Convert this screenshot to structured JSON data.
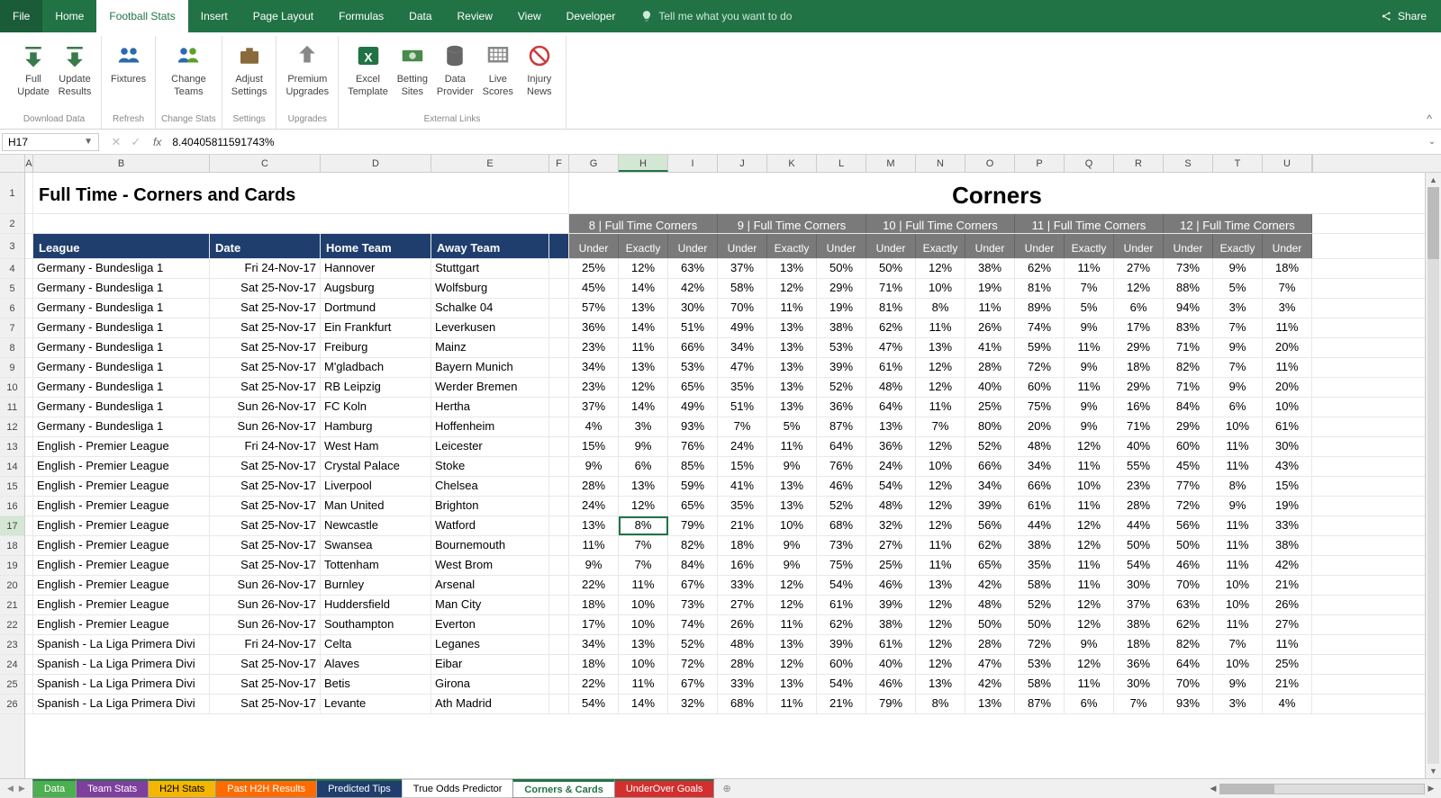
{
  "menu": {
    "file": "File",
    "home": "Home",
    "football": "Football Stats",
    "insert": "Insert",
    "page_layout": "Page Layout",
    "formulas": "Formulas",
    "data": "Data",
    "review": "Review",
    "view": "View",
    "developer": "Developer",
    "tellme": "Tell me what you want to do",
    "share": "Share"
  },
  "ribbon": {
    "full_update": "Full\nUpdate",
    "update_results": "Update\nResults",
    "download_data": "Download Data",
    "fixtures": "Fixtures",
    "refresh": "Refresh",
    "change_teams": "Change\nTeams",
    "change_stats": "Change Stats",
    "adjust_settings": "Adjust\nSettings",
    "settings": "Settings",
    "premium_upgrades": "Premium\nUpgrades",
    "upgrades": "Upgrades",
    "excel_template": "Excel\nTemplate",
    "betting_sites": "Betting\nSites",
    "data_provider": "Data\nProvider",
    "live_scores": "Live\nScores",
    "injury_news": "Injury\nNews",
    "external_links": "External Links"
  },
  "namebox": {
    "ref": "H17"
  },
  "formula": {
    "value": "8.40405811591743%"
  },
  "titles": {
    "main": "Full Time - Corners and Cards",
    "corners": "Corners"
  },
  "col_letters": [
    "A",
    "B",
    "C",
    "D",
    "E",
    "F",
    "G",
    "H",
    "I",
    "J",
    "K",
    "L",
    "M",
    "N",
    "O",
    "P",
    "Q",
    "R",
    "S",
    "T",
    "U"
  ],
  "col_widths": [
    "cw-A",
    "cw-B",
    "cw-C",
    "cw-D",
    "cw-E",
    "cw-F",
    "cw-num",
    "cw-num",
    "cw-num",
    "cw-num",
    "cw-num",
    "cw-num",
    "cw-num",
    "cw-num",
    "cw-num",
    "cw-num",
    "cw-num",
    "cw-num",
    "cw-num",
    "cw-num",
    "cw-num"
  ],
  "headers": {
    "league": "League",
    "date": "Date",
    "home": "Home Team",
    "away": "Away Team",
    "groups": [
      "8 | Full Time Corners",
      "9 | Full Time Corners",
      "10 | Full Time Corners",
      "11 | Full Time Corners",
      "12 | Full Time Corners"
    ],
    "sub": [
      "Under",
      "Exactly",
      "Under"
    ]
  },
  "rows": [
    {
      "n": 4,
      "league": "Germany - Bundesliga 1",
      "date": "Fri 24-Nov-17",
      "home": "Hannover",
      "away": "Stuttgart",
      "v": [
        "25%",
        "12%",
        "63%",
        "37%",
        "13%",
        "50%",
        "50%",
        "12%",
        "38%",
        "62%",
        "11%",
        "27%",
        "73%",
        "9%",
        "18%"
      ]
    },
    {
      "n": 5,
      "league": "Germany - Bundesliga 1",
      "date": "Sat 25-Nov-17",
      "home": "Augsburg",
      "away": "Wolfsburg",
      "v": [
        "45%",
        "14%",
        "42%",
        "58%",
        "12%",
        "29%",
        "71%",
        "10%",
        "19%",
        "81%",
        "7%",
        "12%",
        "88%",
        "5%",
        "7%"
      ]
    },
    {
      "n": 6,
      "league": "Germany - Bundesliga 1",
      "date": "Sat 25-Nov-17",
      "home": "Dortmund",
      "away": "Schalke 04",
      "v": [
        "57%",
        "13%",
        "30%",
        "70%",
        "11%",
        "19%",
        "81%",
        "8%",
        "11%",
        "89%",
        "5%",
        "6%",
        "94%",
        "3%",
        "3%"
      ]
    },
    {
      "n": 7,
      "league": "Germany - Bundesliga 1",
      "date": "Sat 25-Nov-17",
      "home": "Ein Frankfurt",
      "away": "Leverkusen",
      "v": [
        "36%",
        "14%",
        "51%",
        "49%",
        "13%",
        "38%",
        "62%",
        "11%",
        "26%",
        "74%",
        "9%",
        "17%",
        "83%",
        "7%",
        "11%"
      ]
    },
    {
      "n": 8,
      "league": "Germany - Bundesliga 1",
      "date": "Sat 25-Nov-17",
      "home": "Freiburg",
      "away": "Mainz",
      "v": [
        "23%",
        "11%",
        "66%",
        "34%",
        "13%",
        "53%",
        "47%",
        "13%",
        "41%",
        "59%",
        "11%",
        "29%",
        "71%",
        "9%",
        "20%"
      ]
    },
    {
      "n": 9,
      "league": "Germany - Bundesliga 1",
      "date": "Sat 25-Nov-17",
      "home": "M'gladbach",
      "away": "Bayern Munich",
      "v": [
        "34%",
        "13%",
        "53%",
        "47%",
        "13%",
        "39%",
        "61%",
        "12%",
        "28%",
        "72%",
        "9%",
        "18%",
        "82%",
        "7%",
        "11%"
      ]
    },
    {
      "n": 10,
      "league": "Germany - Bundesliga 1",
      "date": "Sat 25-Nov-17",
      "home": "RB Leipzig",
      "away": "Werder Bremen",
      "v": [
        "23%",
        "12%",
        "65%",
        "35%",
        "13%",
        "52%",
        "48%",
        "12%",
        "40%",
        "60%",
        "11%",
        "29%",
        "71%",
        "9%",
        "20%"
      ]
    },
    {
      "n": 11,
      "league": "Germany - Bundesliga 1",
      "date": "Sun 26-Nov-17",
      "home": "FC Koln",
      "away": "Hertha",
      "v": [
        "37%",
        "14%",
        "49%",
        "51%",
        "13%",
        "36%",
        "64%",
        "11%",
        "25%",
        "75%",
        "9%",
        "16%",
        "84%",
        "6%",
        "10%"
      ]
    },
    {
      "n": 12,
      "league": "Germany - Bundesliga 1",
      "date": "Sun 26-Nov-17",
      "home": "Hamburg",
      "away": "Hoffenheim",
      "v": [
        "4%",
        "3%",
        "93%",
        "7%",
        "5%",
        "87%",
        "13%",
        "7%",
        "80%",
        "20%",
        "9%",
        "71%",
        "29%",
        "10%",
        "61%"
      ]
    },
    {
      "n": 13,
      "league": "English - Premier League",
      "date": "Fri 24-Nov-17",
      "home": "West Ham",
      "away": "Leicester",
      "v": [
        "15%",
        "9%",
        "76%",
        "24%",
        "11%",
        "64%",
        "36%",
        "12%",
        "52%",
        "48%",
        "12%",
        "40%",
        "60%",
        "11%",
        "30%"
      ]
    },
    {
      "n": 14,
      "league": "English - Premier League",
      "date": "Sat 25-Nov-17",
      "home": "Crystal Palace",
      "away": "Stoke",
      "v": [
        "9%",
        "6%",
        "85%",
        "15%",
        "9%",
        "76%",
        "24%",
        "10%",
        "66%",
        "34%",
        "11%",
        "55%",
        "45%",
        "11%",
        "43%"
      ]
    },
    {
      "n": 15,
      "league": "English - Premier League",
      "date": "Sat 25-Nov-17",
      "home": "Liverpool",
      "away": "Chelsea",
      "v": [
        "28%",
        "13%",
        "59%",
        "41%",
        "13%",
        "46%",
        "54%",
        "12%",
        "34%",
        "66%",
        "10%",
        "23%",
        "77%",
        "8%",
        "15%"
      ]
    },
    {
      "n": 16,
      "league": "English - Premier League",
      "date": "Sat 25-Nov-17",
      "home": "Man United",
      "away": "Brighton",
      "v": [
        "24%",
        "12%",
        "65%",
        "35%",
        "13%",
        "52%",
        "48%",
        "12%",
        "39%",
        "61%",
        "11%",
        "28%",
        "72%",
        "9%",
        "19%"
      ]
    },
    {
      "n": 17,
      "league": "English - Premier League",
      "date": "Sat 25-Nov-17",
      "home": "Newcastle",
      "away": "Watford",
      "v": [
        "13%",
        "8%",
        "79%",
        "21%",
        "10%",
        "68%",
        "32%",
        "12%",
        "56%",
        "44%",
        "12%",
        "44%",
        "56%",
        "11%",
        "33%"
      ]
    },
    {
      "n": 18,
      "league": "English - Premier League",
      "date": "Sat 25-Nov-17",
      "home": "Swansea",
      "away": "Bournemouth",
      "v": [
        "11%",
        "7%",
        "82%",
        "18%",
        "9%",
        "73%",
        "27%",
        "11%",
        "62%",
        "38%",
        "12%",
        "50%",
        "50%",
        "11%",
        "38%"
      ]
    },
    {
      "n": 19,
      "league": "English - Premier League",
      "date": "Sat 25-Nov-17",
      "home": "Tottenham",
      "away": "West Brom",
      "v": [
        "9%",
        "7%",
        "84%",
        "16%",
        "9%",
        "75%",
        "25%",
        "11%",
        "65%",
        "35%",
        "11%",
        "54%",
        "46%",
        "11%",
        "42%"
      ]
    },
    {
      "n": 20,
      "league": "English - Premier League",
      "date": "Sun 26-Nov-17",
      "home": "Burnley",
      "away": "Arsenal",
      "v": [
        "22%",
        "11%",
        "67%",
        "33%",
        "12%",
        "54%",
        "46%",
        "13%",
        "42%",
        "58%",
        "11%",
        "30%",
        "70%",
        "10%",
        "21%"
      ]
    },
    {
      "n": 21,
      "league": "English - Premier League",
      "date": "Sun 26-Nov-17",
      "home": "Huddersfield",
      "away": "Man City",
      "v": [
        "18%",
        "10%",
        "73%",
        "27%",
        "12%",
        "61%",
        "39%",
        "12%",
        "48%",
        "52%",
        "12%",
        "37%",
        "63%",
        "10%",
        "26%"
      ]
    },
    {
      "n": 22,
      "league": "English - Premier League",
      "date": "Sun 26-Nov-17",
      "home": "Southampton",
      "away": "Everton",
      "v": [
        "17%",
        "10%",
        "74%",
        "26%",
        "11%",
        "62%",
        "38%",
        "12%",
        "50%",
        "50%",
        "12%",
        "38%",
        "62%",
        "11%",
        "27%"
      ]
    },
    {
      "n": 23,
      "league": "Spanish - La Liga Primera Divi",
      "date": "Fri 24-Nov-17",
      "home": "Celta",
      "away": "Leganes",
      "v": [
        "34%",
        "13%",
        "52%",
        "48%",
        "13%",
        "39%",
        "61%",
        "12%",
        "28%",
        "72%",
        "9%",
        "18%",
        "82%",
        "7%",
        "11%"
      ]
    },
    {
      "n": 24,
      "league": "Spanish - La Liga Primera Divi",
      "date": "Sat 25-Nov-17",
      "home": "Alaves",
      "away": "Eibar",
      "v": [
        "18%",
        "10%",
        "72%",
        "28%",
        "12%",
        "60%",
        "40%",
        "12%",
        "47%",
        "53%",
        "12%",
        "36%",
        "64%",
        "10%",
        "25%"
      ]
    },
    {
      "n": 25,
      "league": "Spanish - La Liga Primera Divi",
      "date": "Sat 25-Nov-17",
      "home": "Betis",
      "away": "Girona",
      "v": [
        "22%",
        "11%",
        "67%",
        "33%",
        "13%",
        "54%",
        "46%",
        "13%",
        "42%",
        "58%",
        "11%",
        "30%",
        "70%",
        "9%",
        "21%"
      ]
    },
    {
      "n": 26,
      "league": "Spanish - La Liga Primera Divi",
      "date": "Sat 25-Nov-17",
      "home": "Levante",
      "away": "Ath Madrid",
      "v": [
        "54%",
        "14%",
        "32%",
        "68%",
        "11%",
        "21%",
        "79%",
        "8%",
        "13%",
        "87%",
        "6%",
        "7%",
        "93%",
        "3%",
        "4%"
      ]
    }
  ],
  "sheets": [
    {
      "label": "Data",
      "bg": "#4caf50",
      "fg": "#fff"
    },
    {
      "label": "Team Stats",
      "bg": "#7e3f9d",
      "fg": "#fff"
    },
    {
      "label": "H2H Stats",
      "bg": "#f4b600",
      "fg": "#000"
    },
    {
      "label": "Past H2H Results",
      "bg": "#ff6b00",
      "fg": "#fff"
    },
    {
      "label": "Predicted Tips",
      "bg": "#1f3e6e",
      "fg": "#fff"
    },
    {
      "label": "True Odds Predictor",
      "bg": "#fff",
      "fg": "#000",
      "plain": true
    },
    {
      "label": "Corners & Cards",
      "bg": "#fff",
      "fg": "#217346",
      "active": true
    },
    {
      "label": "UnderOver Goals",
      "bg": "#d32f2f",
      "fg": "#fff"
    }
  ],
  "selected": {
    "row": 17,
    "col": "H"
  }
}
